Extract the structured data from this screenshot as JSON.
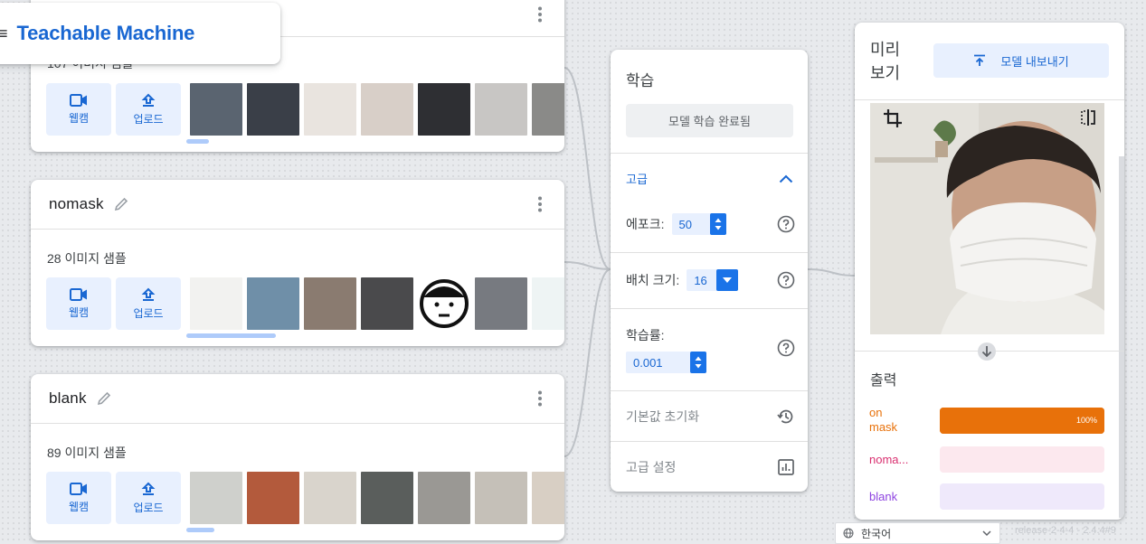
{
  "app": {
    "title": "Teachable Machine",
    "menu_glyph": "≡"
  },
  "tools": {
    "webcam_label": "웹캠",
    "upload_label": "업로드"
  },
  "classes": [
    {
      "name": "",
      "sample_count": "107 이미지 샘플",
      "thumb_colors": [
        "#5a6470",
        "#3a3f48",
        "#e9e4df",
        "#d8cfc8",
        "#2e2f33",
        "#c8c6c4",
        "#8a8a88",
        "#bdbdbd"
      ]
    },
    {
      "name": "nomask",
      "sample_count": "28 이미지 샘플",
      "thumb_colors": [
        "#f2f2f0",
        "#6f8fa8",
        "#8a7b70",
        "#4a4a4c",
        "#ffffff",
        "#777a80",
        "#eef4f4"
      ]
    },
    {
      "name": "blank",
      "sample_count": "89 이미지 샘플",
      "thumb_colors": [
        "#cfd0cc",
        "#b35a3c",
        "#d9d4cc",
        "#5a5e5c",
        "#9a9894",
        "#c5c0b8",
        "#d8cfc4"
      ]
    }
  ],
  "training": {
    "title": "학습",
    "train_button": "모델 학습 완료됨",
    "advanced_label": "고급",
    "epochs_label": "에포크:",
    "epochs_value": "50",
    "batch_label": "배치 크기:",
    "batch_value": "16",
    "lr_label": "학습률:",
    "lr_value": "0.001",
    "reset_label": "기본값 초기화",
    "advanced_settings_label": "고급 설정"
  },
  "preview": {
    "title": "미리 보기",
    "export_button": "모델 내보내기",
    "output_title": "출력",
    "outputs": [
      {
        "label": "on mask",
        "percent": 100,
        "percent_text": "100%",
        "color": "#e8710a",
        "track": "#e8710a"
      },
      {
        "label": "noma...",
        "percent": 0,
        "percent_text": "",
        "color": "#d93070",
        "track": "#fce8ee"
      },
      {
        "label": "blank",
        "percent": 0,
        "percent_text": "",
        "color": "#8e44e0",
        "track": "#efe9fb"
      }
    ]
  },
  "footer": {
    "language": "한국어",
    "release": "release-2-4-4 - 2.4.4#9"
  },
  "colors": {
    "accent": "#1967d2",
    "primary_button": "#1a73e8"
  }
}
